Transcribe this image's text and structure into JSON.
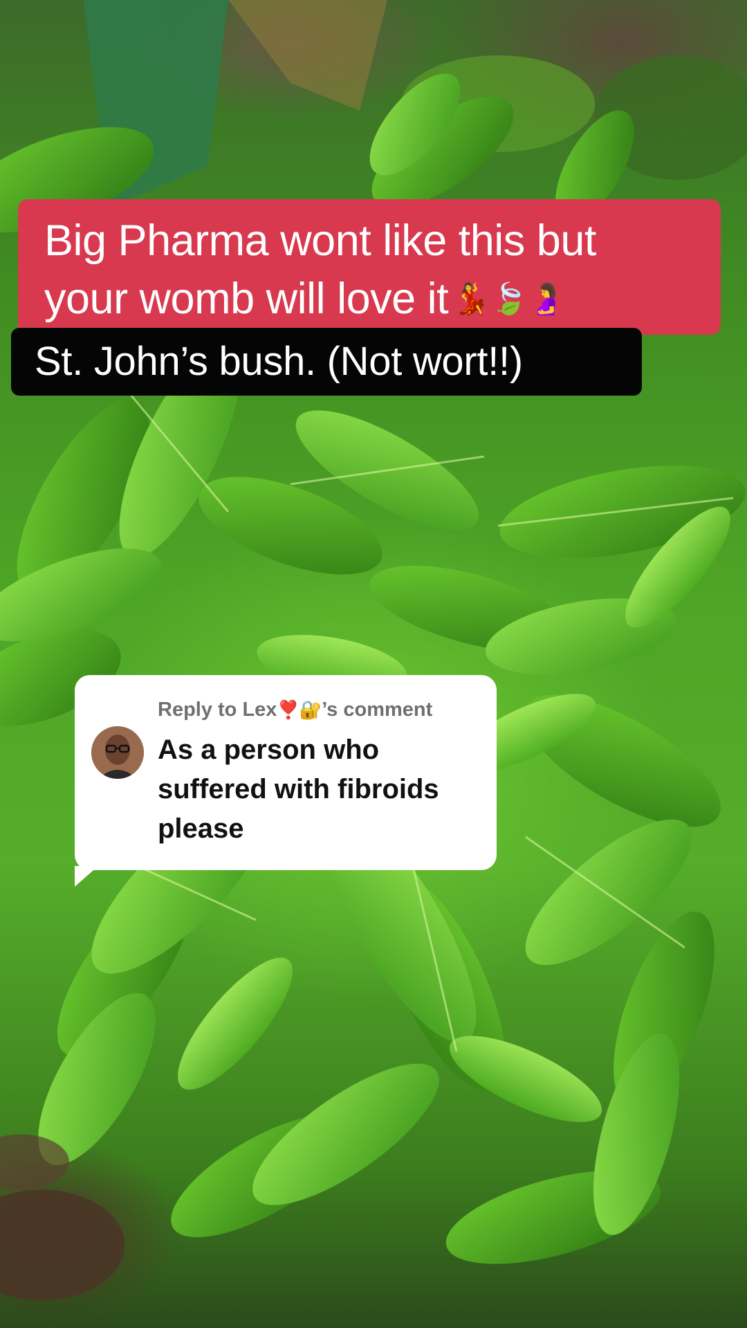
{
  "overlay": {
    "title_line_1": "Big Pharma wont like this but",
    "title_line_2": "your womb will love it",
    "title_emojis": "💃🍃🤰",
    "subtitle": "St. John’s bush. (Not wort!!)"
  },
  "reply": {
    "prefix": "Reply to Lex",
    "emojis": "❣️🔐",
    "suffix": "’s comment",
    "body": "As a person who suffered with fibroids please"
  },
  "colors": {
    "title_bg": "#d8394f",
    "subtitle_bg": "#050505",
    "reply_bg": "#ffffff",
    "reply_header": "#6f6f6f"
  }
}
